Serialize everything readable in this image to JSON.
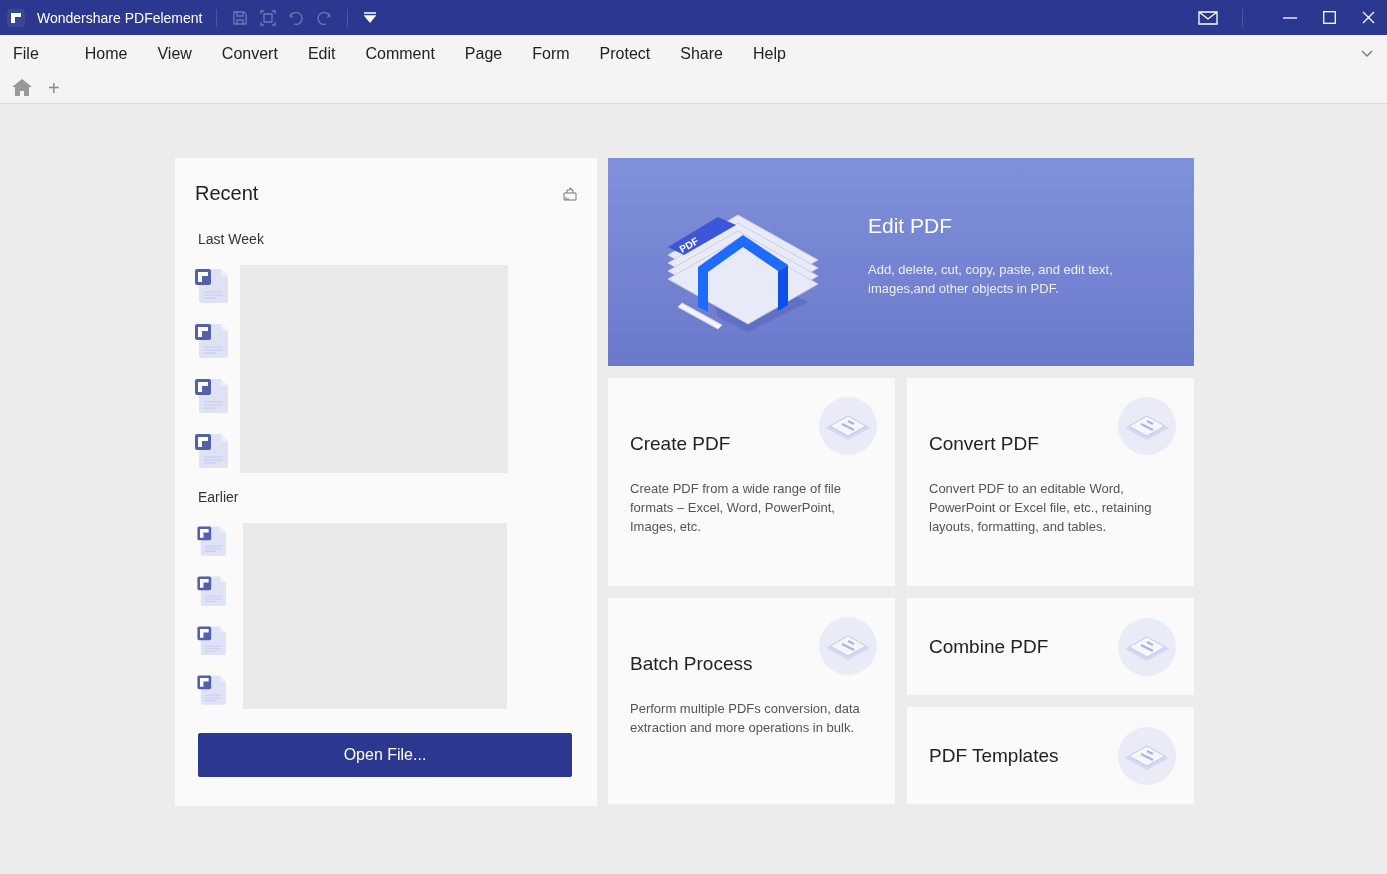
{
  "window": {
    "title": "Wondershare PDFelement"
  },
  "menu": [
    {
      "label": "File"
    },
    {
      "label": "Home"
    },
    {
      "label": "View"
    },
    {
      "label": "Convert"
    },
    {
      "label": "Edit"
    },
    {
      "label": "Comment"
    },
    {
      "label": "Page"
    },
    {
      "label": "Form"
    },
    {
      "label": "Protect"
    },
    {
      "label": "Share"
    },
    {
      "label": "Help"
    }
  ],
  "tabs": {
    "add": "+"
  },
  "recent": {
    "title": "Recent",
    "sections": [
      {
        "label": "Last Week"
      },
      {
        "label": "Earlier"
      }
    ],
    "open_button": "Open File..."
  },
  "cards": [
    {
      "kind": "hero",
      "art_label": "PDF",
      "title": "Edit PDF",
      "description": "Add, delete, cut, copy, paste, and edit text, images,and other objects in PDF."
    },
    {
      "kind": "normal",
      "title": "Create PDF",
      "description": "Create PDF from a wide range of file formats – Excel, Word, PowerPoint, Images, etc."
    },
    {
      "kind": "normal",
      "title": "Convert PDF",
      "description": "Convert PDF to an editable Word, PowerPoint or Excel file, etc., retaining layouts, formatting, and tables."
    },
    {
      "kind": "short",
      "title": "Combine PDF"
    },
    {
      "kind": "tall",
      "title": "Batch Process",
      "description": "Perform multiple PDFs conversion, data extraction and more operations in bulk."
    },
    {
      "kind": "short",
      "title": "PDF Templates"
    }
  ]
}
